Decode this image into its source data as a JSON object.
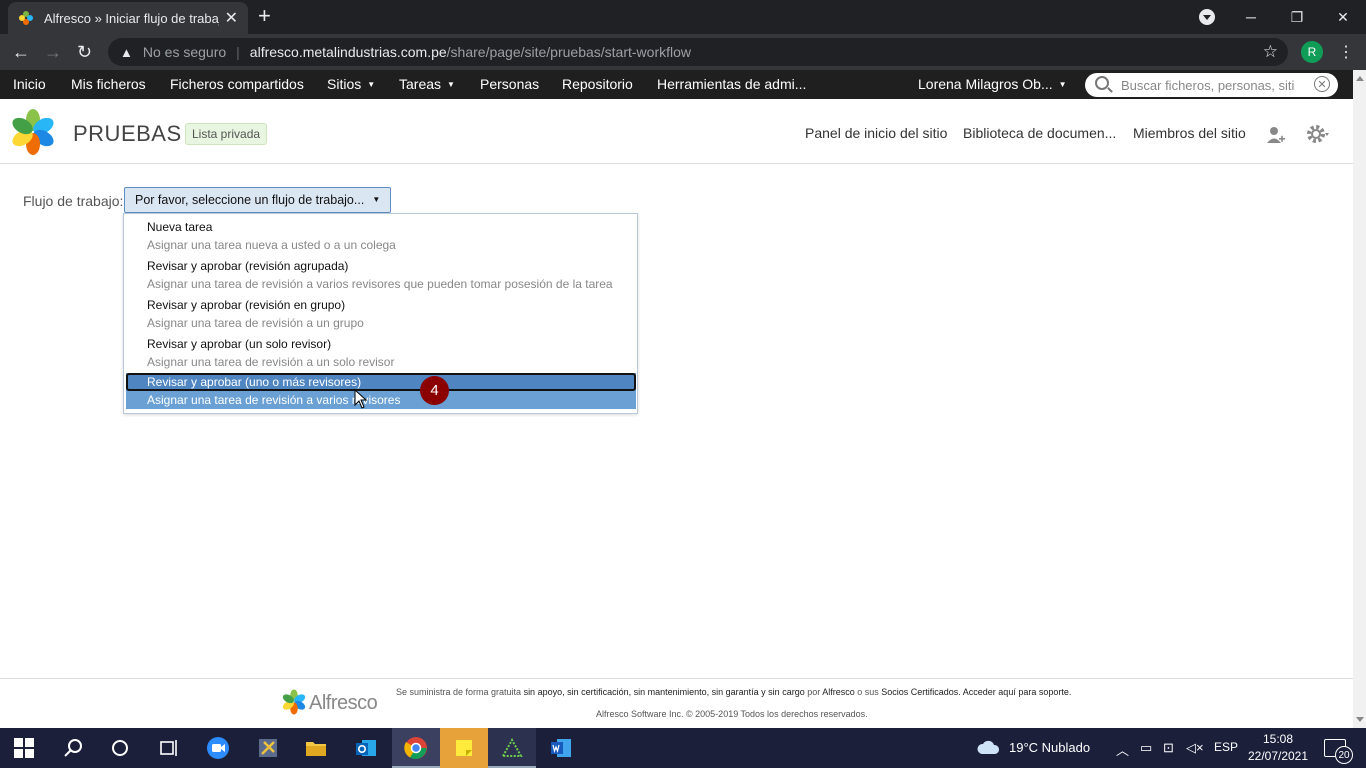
{
  "browser": {
    "tab_title": "Alfresco » Iniciar flujo de trabajo",
    "security_label": "No es seguro",
    "url_host": "alfresco.metalindustrias.com.pe",
    "url_path": "/share/page/site/pruebas/start-workflow",
    "profile_initial": "R"
  },
  "app_nav": {
    "items": [
      "Inicio",
      "Mis ficheros",
      "Ficheros compartidos",
      "Sitios",
      "Tareas",
      "Personas",
      "Repositorio",
      "Herramientas de admi..."
    ],
    "user_name": "Lorena Milagros Ob...",
    "search_placeholder": "Buscar ficheros, personas, siti"
  },
  "site": {
    "name": "PRUEBAS",
    "visibility": "Lista privada",
    "links": [
      "Panel de inicio del sitio",
      "Biblioteca de documen...",
      "Miembros del sitio"
    ]
  },
  "workflow": {
    "label": "Flujo de trabajo:",
    "button_label": "Por favor, seleccione un flujo de trabajo...",
    "options": [
      {
        "title": "Nueva tarea",
        "desc": "Asignar una tarea nueva a usted o a un colega"
      },
      {
        "title": "Revisar y aprobar (revisión agrupada)",
        "desc": "Asignar una tarea de revisión a varios revisores que pueden tomar posesión de la tarea"
      },
      {
        "title": "Revisar y aprobar (revisión en grupo)",
        "desc": "Asignar una tarea de revisión a un grupo"
      },
      {
        "title": "Revisar y aprobar (un solo revisor)",
        "desc": "Asignar una tarea de revisión a un solo revisor"
      },
      {
        "title": "Revisar y aprobar (uno o más revisores)",
        "desc": "Asignar una tarea de revisión a varios revisores"
      }
    ],
    "selected_index": 4,
    "step_badge": "4"
  },
  "footer": {
    "brand": "Alfresco",
    "line1_a": "Se suministra de forma gratuita ",
    "line1_b": "sin apoyo, sin certificación, sin mantenimiento, sin garantía y sin cargo",
    "line1_c": " por ",
    "line1_d": "Alfresco",
    "line1_e": " o sus ",
    "line1_f": "Socios Certificados. Acceder aquí para soporte.",
    "line2": "Alfresco Software Inc. © 2005-2019 Todos los derechos reservados."
  },
  "taskbar": {
    "weather": "19°C  Nublado",
    "lang": "ESP",
    "time": "15:08",
    "date": "22/07/2021",
    "notifications": "20"
  },
  "colors": {
    "accent": "#6aa0d3",
    "badge": "#8b0000",
    "nav_bg": "#1f1f1f"
  }
}
